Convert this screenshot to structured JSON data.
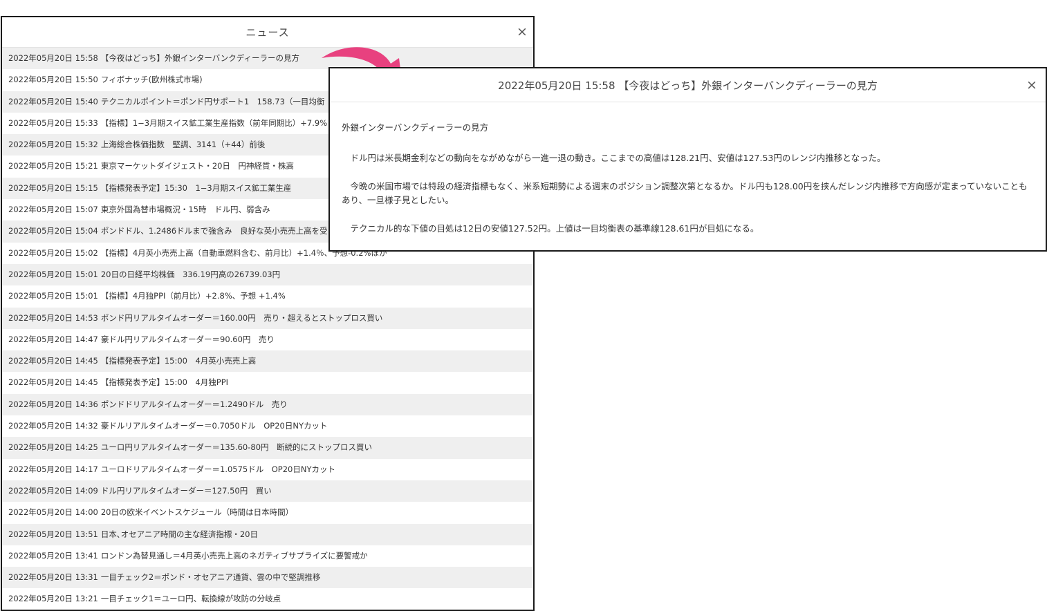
{
  "news_window": {
    "title": "ニュース",
    "close_label": "×",
    "items": [
      {
        "time": "2022年05月20日 15:58",
        "headline": "【今夜はどっち】外銀インターバンクディーラーの見方"
      },
      {
        "time": "2022年05月20日 15:50",
        "headline": "フィボナッチ(欧州株式市場)"
      },
      {
        "time": "2022年05月20日 15:40",
        "headline": "テクニカルポイント＝ポンド円サポート1　158.73（一目均衡"
      },
      {
        "time": "2022年05月20日 15:33",
        "headline": "【指標】1−3月期スイス鉱工業生産指数（前年同期比）+7.9%"
      },
      {
        "time": "2022年05月20日 15:32",
        "headline": "上海総合株価指数　堅調、3141（+44）前後"
      },
      {
        "time": "2022年05月20日 15:21",
        "headline": "東京マーケットダイジェスト・20日　円神経質・株高"
      },
      {
        "time": "2022年05月20日 15:15",
        "headline": "【指標発表予定】15:30　1−3月期スイス鉱工業生産"
      },
      {
        "time": "2022年05月20日 15:07",
        "headline": "東京外国為替市場概況・15時　ドル円、弱含み"
      },
      {
        "time": "2022年05月20日 15:04",
        "headline": "ポンドドル、1.2486ドルまで強含み　良好な英小売売上高を受"
      },
      {
        "time": "2022年05月20日 15:02",
        "headline": "【指標】4月英小売売上高（自動車燃料含む、前月比）+1.4％、予想-0.2%ほか"
      },
      {
        "time": "2022年05月20日 15:01",
        "headline": "20日の日経平均株価　336.19円高の26739.03円"
      },
      {
        "time": "2022年05月20日 15:01",
        "headline": "【指標】4月独PPI（前月比）+2.8%、予想 +1.4%"
      },
      {
        "time": "2022年05月20日 14:53",
        "headline": "ポンド円リアルタイムオーダー＝160.00円　売り・超えるとストップロス買い"
      },
      {
        "time": "2022年05月20日 14:47",
        "headline": "豪ドル円リアルタイムオーダー＝90.60円　売り"
      },
      {
        "time": "2022年05月20日 14:45",
        "headline": "【指標発表予定】15:00　4月英小売売上高"
      },
      {
        "time": "2022年05月20日 14:45",
        "headline": "【指標発表予定】15:00　4月独PPI"
      },
      {
        "time": "2022年05月20日 14:36",
        "headline": "ポンドドリアルタイムオーダー＝1.2490ドル　売り"
      },
      {
        "time": "2022年05月20日 14:32",
        "headline": "豪ドルリアルタイムオーダー＝0.7050ドル　OP20日NYカット"
      },
      {
        "time": "2022年05月20日 14:25",
        "headline": "ユーロ円リアルタイムオーダー＝135.60-80円　断続的にストップロス買い"
      },
      {
        "time": "2022年05月20日 14:17",
        "headline": "ユーロドリアルタイムオーダー＝1.0575ドル　OP20日NYカット"
      },
      {
        "time": "2022年05月20日 14:09",
        "headline": "ドル円リアルタイムオーダー＝127.50円　買い"
      },
      {
        "time": "2022年05月20日 14:00",
        "headline": "20日の欧米イベントスケジュール（時間は日本時間）"
      },
      {
        "time": "2022年05月20日 13:51",
        "headline": "日本､オセアニア時間の主な経済指標・20日"
      },
      {
        "time": "2022年05月20日 13:41",
        "headline": "ロンドン為替見通し＝4月英小売売上高のネガティブサプライズに要警戒か"
      },
      {
        "time": "2022年05月20日 13:31",
        "headline": "一目チェック2＝ポンド・オセアニア通貨、雲の中で堅調推移"
      },
      {
        "time": "2022年05月20日 13:21",
        "headline": "一目チェック1＝ユーロ円、転換線が攻防の分岐点"
      }
    ]
  },
  "arrow_color": "#e8417f",
  "detail_window": {
    "title": "2022年05月20日 15:58 【今夜はどっち】外銀インターバンクディーラーの見方",
    "close_label": "×",
    "heading": "外銀インターバンクディーラーの見方",
    "paragraphs": [
      "ドル円は米長期金利などの動向をながめながら一進一退の動き。ここまでの高値は128.21円、安値は127.53円のレンジ内推移となった。",
      "今晩の米国市場では特段の経済指標もなく、米系短期勢による週末のポジション調整次第となるか。ドル円も128.00円を挟んだレンジ内推移で方向感が定まっていないこともあり、一旦様子見としたい。",
      "テクニカル的な下値の目処は12日の安値127.52円。上値は一目均衡表の基準線128.61円が目処になる。"
    ]
  }
}
